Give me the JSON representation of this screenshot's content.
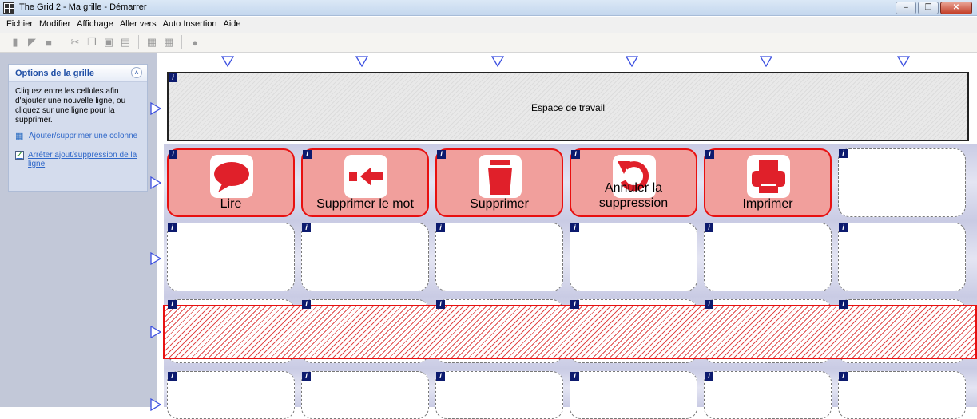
{
  "window": {
    "title": "The Grid 2 - Ma grille - Démarrer",
    "controls": [
      "minimize",
      "restore",
      "close"
    ]
  },
  "menu": [
    "Fichier",
    "Modifier",
    "Affichage",
    "Aller vers",
    "Auto Insertion",
    "Aide"
  ],
  "toolbar": {
    "icons": [
      "new-file-icon",
      "open-file-icon",
      "save-icon",
      "cut-icon",
      "copy-icon",
      "paste-icon",
      "paste-special-icon",
      "grid-icon",
      "grid-small-icon",
      "record-icon"
    ]
  },
  "panel": {
    "title": "Options de la grille",
    "description": "Cliquez entre les cellules afin d'ajouter une nouvelle ligne, ou cliquez sur une ligne pour la supprimer.",
    "link_add_column": "Ajouter/supprimer une colonne",
    "link_stop_add_row": "Arrêter ajout/suppression de la ligne"
  },
  "grid": {
    "workspace_label": "Espace de travail",
    "info_badge": "i",
    "command_row": [
      {
        "label": "Lire",
        "icon": "speech-bubble-icon"
      },
      {
        "label": "Supprimer le mot",
        "icon": "delete-word-arrow-icon"
      },
      {
        "label": "Supprimer",
        "icon": "trash-can-icon"
      },
      {
        "label": "Annuler la suppression",
        "icon": "undo-icon"
      },
      {
        "label": "Imprimer",
        "icon": "printer-icon"
      },
      {
        "label": "",
        "icon": ""
      }
    ],
    "colors": {
      "command_cell_fill": "#f19f9c",
      "command_cell_border": "#e81010",
      "symbol_red": "#e0202a",
      "row_band": "#c9cbe4",
      "arrow": "#3b4fe0"
    }
  }
}
